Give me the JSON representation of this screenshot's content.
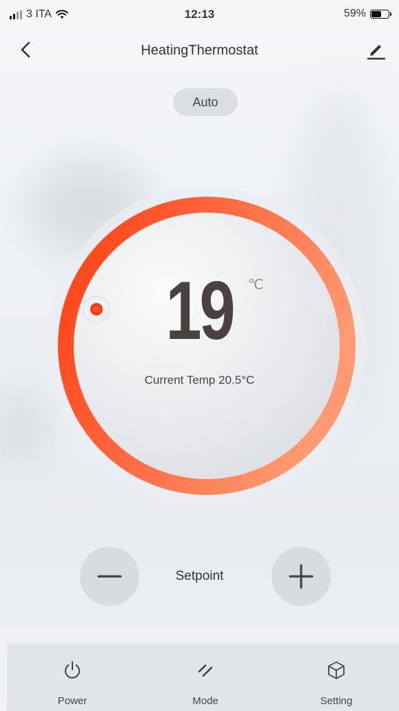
{
  "status_bar": {
    "carrier": "3 ITA",
    "time": "12:13",
    "battery_text": "59%",
    "battery_level": 0.59
  },
  "nav": {
    "title": "HeatingThermostat"
  },
  "mode": {
    "label": "Auto"
  },
  "dial": {
    "setpoint": "19",
    "unit": "℃",
    "current_temp": "Current Temp 20.5°C",
    "accent_start": "#ff3a0f",
    "accent_end": "#ff9a72"
  },
  "controls": {
    "setpoint_label": "Setpoint"
  },
  "tabbar": {
    "power_label": "Power",
    "mode_label": "Mode",
    "setting_label": "Setting"
  }
}
